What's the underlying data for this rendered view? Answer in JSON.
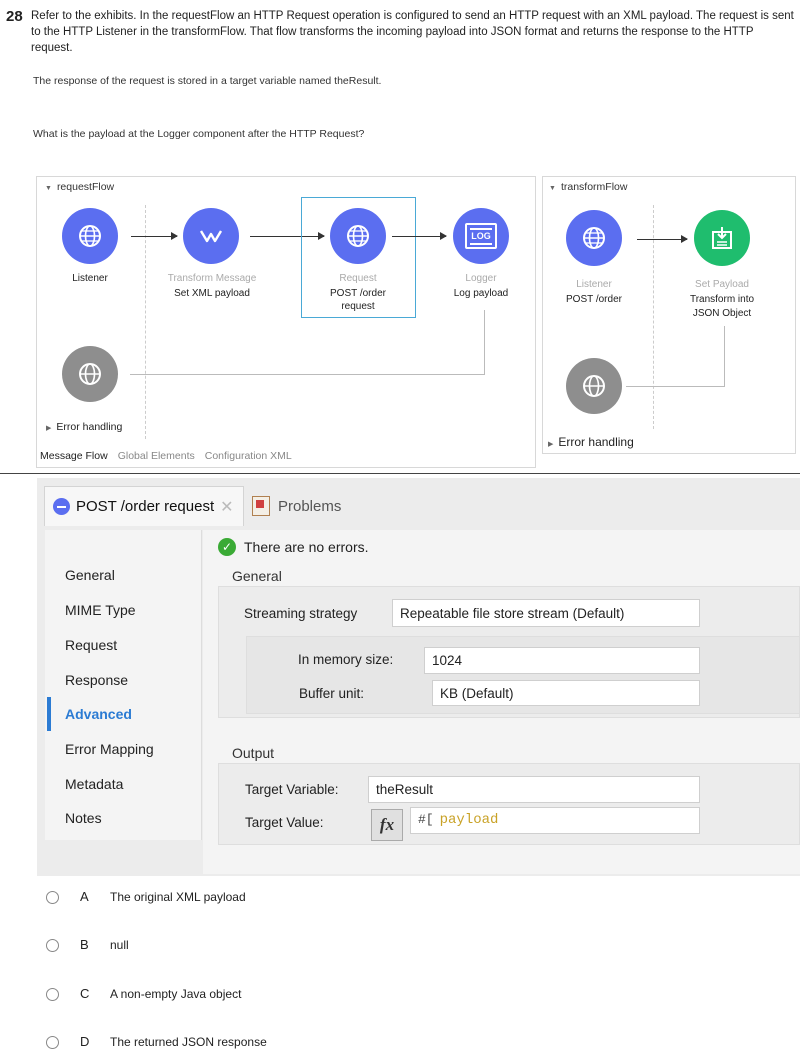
{
  "question": {
    "number": "28",
    "text": "Refer to the exhibits. In the requestFlow an HTTP Request operation is configured to send an HTTP request with an XML payload. The request is sent to the HTTP Listener in the transformFlow. That flow transforms the incoming payload into JSON format and returns the response to the HTTP request.",
    "note": "The response of the request is stored in a target variable named theResult.",
    "ask": "What is the payload at the Logger component after the HTTP Request?"
  },
  "request_flow": {
    "title": "requestFlow",
    "listener": {
      "label": "Listener",
      "icon": "globe-icon"
    },
    "transform": {
      "type": "Transform Message",
      "label": "Set XML payload",
      "icon": "transform-icon"
    },
    "request": {
      "type": "Request",
      "label1": "POST /order",
      "label2": "request",
      "icon": "globe-icon"
    },
    "logger": {
      "type": "Logger",
      "label": "Log payload",
      "icon_text": "LOG"
    },
    "error_handling": "Error handling"
  },
  "transform_flow": {
    "title": "transformFlow",
    "listener": {
      "type": "Listener",
      "label": "POST /order"
    },
    "set_payload": {
      "type": "Set Payload",
      "label1": "Transform into",
      "label2": "JSON Object"
    },
    "error_handling": "Error handling"
  },
  "bottom_tabs": [
    "Message Flow",
    "Global Elements",
    "Configuration XML"
  ],
  "props": {
    "tab_title": "POST /order request",
    "tab_problems": "Problems",
    "status": "There are no errors.",
    "nav": [
      "General",
      "MIME Type",
      "Request",
      "Response",
      "Advanced",
      "Error Mapping",
      "Metadata",
      "Notes"
    ],
    "active_nav": "Advanced",
    "general_header": "General",
    "streaming_label": "Streaming strategy",
    "streaming_value": "Repeatable file store stream (Default)",
    "memory_label": "In memory size:",
    "memory_value": "1024",
    "buffer_label": "Buffer unit:",
    "buffer_value": "KB (Default)",
    "output_header": "Output",
    "target_var_label": "Target Variable:",
    "target_var_value": "theResult",
    "target_val_label": "Target Value:",
    "fx": "fx",
    "target_val_prefix": "#[",
    "target_val_expr": "payload"
  },
  "options": [
    {
      "letter": "A",
      "text": "The original XML payload"
    },
    {
      "letter": "B",
      "text": "null"
    },
    {
      "letter": "C",
      "text": "A non-empty Java object"
    },
    {
      "letter": "D",
      "text": "The returned JSON response"
    }
  ]
}
